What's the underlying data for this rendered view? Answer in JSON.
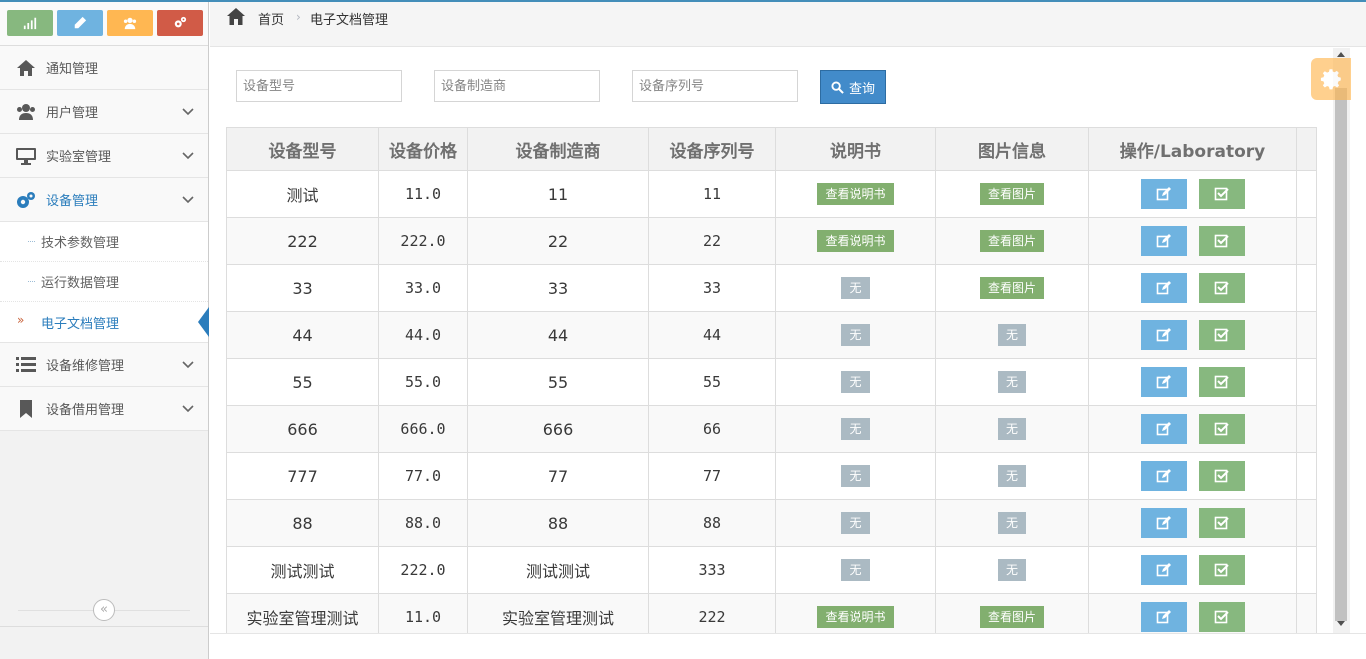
{
  "shortcuts": [
    {
      "name": "signal-icon",
      "color": "#87b87f"
    },
    {
      "name": "pencil-icon",
      "color": "#6fb3e0"
    },
    {
      "name": "users-icon",
      "color": "#ffb752"
    },
    {
      "name": "cogs-icon",
      "color": "#d15b47"
    }
  ],
  "sidebar": {
    "items": [
      {
        "label": "通知管理",
        "icon": "home-icon"
      },
      {
        "label": "用户管理",
        "icon": "users-icon"
      },
      {
        "label": "实验室管理",
        "icon": "desktop-icon"
      },
      {
        "label": "设备管理",
        "icon": "cogs-icon"
      },
      {
        "label": "设备维修管理",
        "icon": "list-icon"
      },
      {
        "label": "设备借用管理",
        "icon": "bookmark-icon"
      }
    ],
    "sub_items": [
      {
        "label": "技术参数管理"
      },
      {
        "label": "运行数据管理"
      },
      {
        "label": "电子文档管理"
      }
    ],
    "collapse_glyph": "«"
  },
  "breadcrumb": {
    "home": "首页",
    "sep": "›",
    "current": "电子文档管理"
  },
  "search": {
    "model_placeholder": "设备型号",
    "maker_placeholder": "设备制造商",
    "serial_placeholder": "设备序列号",
    "button_label": "查询"
  },
  "table": {
    "headers": [
      "设备型号",
      "设备价格",
      "设备制造商",
      "设备序列号",
      "说明书",
      "图片信息",
      "操作/Laboratory"
    ],
    "rows": [
      {
        "model": "测试",
        "price": "11.0",
        "maker": "11",
        "serial": "11",
        "manual": "查看说明书",
        "image": "查看图片"
      },
      {
        "model": "222",
        "price": "222.0",
        "maker": "22",
        "serial": "22",
        "manual": "查看说明书",
        "image": "查看图片"
      },
      {
        "model": "33",
        "price": "33.0",
        "maker": "33",
        "serial": "33",
        "manual": "无",
        "image": "查看图片"
      },
      {
        "model": "44",
        "price": "44.0",
        "maker": "44",
        "serial": "44",
        "manual": "无",
        "image": "无"
      },
      {
        "model": "55",
        "price": "55.0",
        "maker": "55",
        "serial": "55",
        "manual": "无",
        "image": "无"
      },
      {
        "model": "666",
        "price": "666.0",
        "maker": "666",
        "serial": "66",
        "manual": "无",
        "image": "无"
      },
      {
        "model": "777",
        "price": "77.0",
        "maker": "77",
        "serial": "77",
        "manual": "无",
        "image": "无"
      },
      {
        "model": "88",
        "price": "88.0",
        "maker": "88",
        "serial": "88",
        "manual": "无",
        "image": "无"
      },
      {
        "model": "测试测试",
        "price": "222.0",
        "maker": "测试测试",
        "serial": "333",
        "manual": "无",
        "image": "无"
      },
      {
        "model": "实验室管理测试",
        "price": "11.0",
        "maker": "实验室管理测试",
        "serial": "222",
        "manual": "查看说明书",
        "image": "查看图片"
      }
    ]
  },
  "colors": {
    "accent": "#438eb9",
    "primary_button": "#428bca",
    "success_label": "#82af6f",
    "none_label": "#abbac3",
    "edit_button": "#6fb3e0",
    "check_button": "#87b87f"
  }
}
